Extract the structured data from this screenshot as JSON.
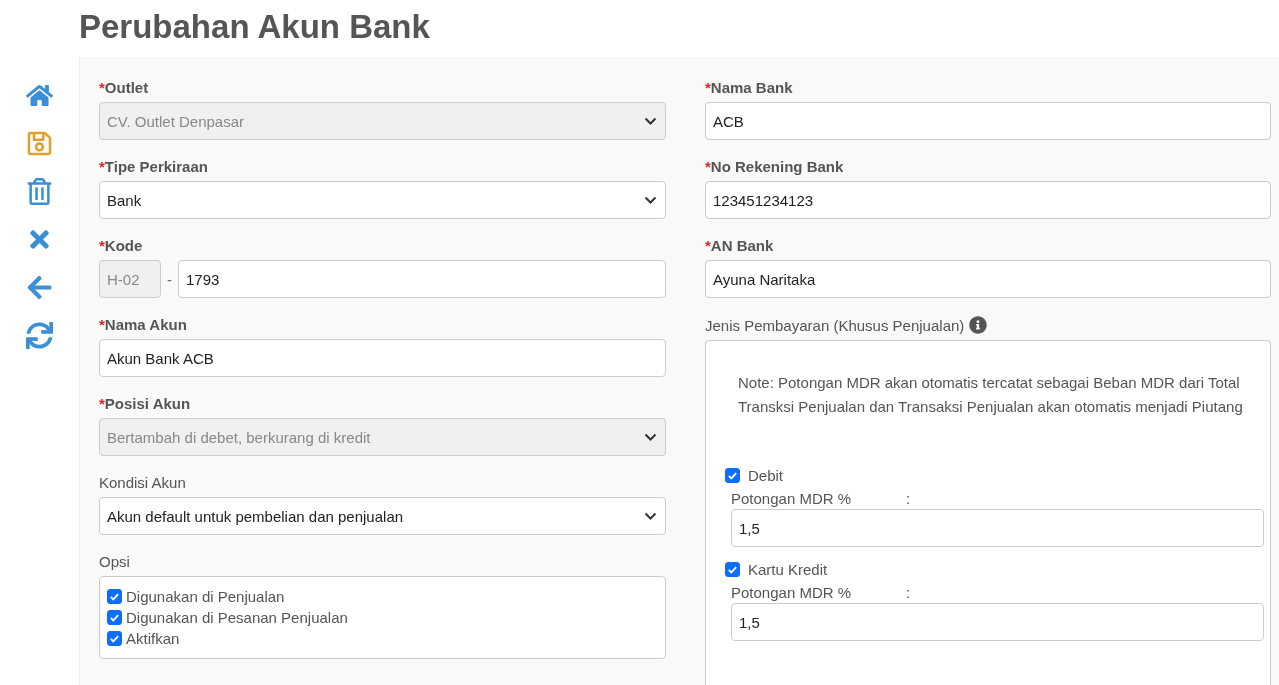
{
  "title": "Perubahan Akun Bank",
  "toolbar": [
    {
      "kind": "home"
    },
    {
      "kind": "save"
    },
    {
      "kind": "delete"
    },
    {
      "kind": "close"
    },
    {
      "kind": "back"
    },
    {
      "kind": "refresh"
    }
  ],
  "left_fields": [
    {
      "kind": "select",
      "required_mark": "*",
      "label": "Outlet",
      "value": "CV. Outlet Denpasar",
      "disabled": true
    },
    {
      "kind": "select",
      "required_mark": "*",
      "label": "Tipe Perkiraan",
      "value": "Bank",
      "disabled": false
    },
    {
      "kind": "code",
      "required_mark": "*",
      "label": "Kode",
      "prefix": "H-02",
      "separator": "-",
      "value": "1793"
    },
    {
      "kind": "input",
      "required_mark": "*",
      "label": "Nama Akun",
      "value": "Akun Bank ACB"
    },
    {
      "kind": "select",
      "required_mark": "*",
      "label": "Posisi Akun",
      "value": "Bertambah di debet, berkurang di kredit",
      "disabled": true
    },
    {
      "kind": "select",
      "label": "Kondisi Akun",
      "value": "Akun default untuk pembelian dan penjualan",
      "disabled": false
    },
    {
      "kind": "checklist",
      "label": "Opsi",
      "options": [
        {
          "label": "Digunakan di Penjualan",
          "checked": true
        },
        {
          "label": "Digunakan di Pesanan Penjualan",
          "checked": true
        },
        {
          "label": "Aktifkan",
          "checked": true
        }
      ]
    }
  ],
  "right_fields": [
    {
      "kind": "input",
      "required_mark": "*",
      "label": "Nama Bank",
      "value": "ACB"
    },
    {
      "kind": "input",
      "required_mark": "*",
      "label": "No Rekening Bank",
      "value": "123451234123"
    },
    {
      "kind": "input",
      "required_mark": "*",
      "label": "AN Bank",
      "value": "Ayuna Naritaka"
    }
  ],
  "payment": {
    "label": "Jenis Pembayaran (Khusus Penjualan)",
    "note": "Note: Potongan MDR akan otomatis tercatat sebagai Beban MDR dari Total Transksi Penjualan dan Transaksi Penjualan akan otomatis menjadi Piutang",
    "methods": [
      {
        "label": "Debit",
        "checked": true,
        "mdr_label": "Potongan MDR %",
        "colon": ":",
        "value": "1,5"
      },
      {
        "label": "Kartu Kredit",
        "checked": true,
        "mdr_label": "Potongan MDR %",
        "colon": ":",
        "value": "1,5"
      }
    ]
  }
}
